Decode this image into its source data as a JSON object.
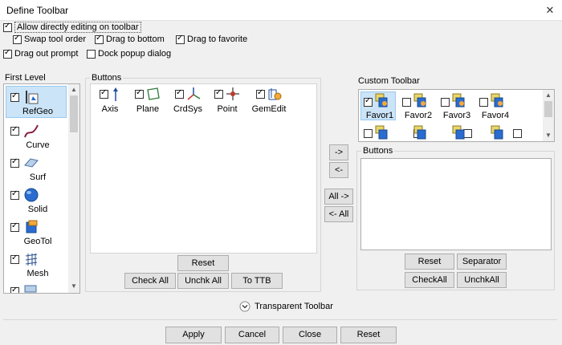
{
  "window": {
    "title": "Define Toolbar",
    "close_glyph": "✕"
  },
  "options": {
    "allow_direct_edit": "Allow directly editing on toolbar",
    "swap_tool_order": "Swap tool order",
    "drag_to_bottom": "Drag to bottom",
    "drag_to_favorite": "Drag to favorite",
    "drag_out_prompt": "Drag out prompt",
    "dock_popup_dialog": "Dock popup dialog"
  },
  "first_level": {
    "label": "First Level",
    "items": [
      {
        "label": "RefGeo",
        "icon": "refgeo-icon",
        "checked": true,
        "selected": true
      },
      {
        "label": "Curve",
        "icon": "curve-icon",
        "checked": true
      },
      {
        "label": "Surf",
        "icon": "surf-icon",
        "checked": true
      },
      {
        "label": "Solid",
        "icon": "solid-icon",
        "checked": true
      },
      {
        "label": "GeoTol",
        "icon": "geotol-icon",
        "checked": true
      },
      {
        "label": "Mesh",
        "icon": "mesh-icon",
        "checked": true
      }
    ]
  },
  "buttons_group": {
    "label": "Buttons",
    "tools": [
      {
        "label": "Axis",
        "icon": "axis-icon",
        "checked": true
      },
      {
        "label": "Plane",
        "icon": "plane-icon",
        "checked": true
      },
      {
        "label": "CrdSys",
        "icon": "crdsys-icon",
        "checked": true
      },
      {
        "label": "Point",
        "icon": "point-icon",
        "checked": true
      },
      {
        "label": "GemEdit",
        "icon": "gemedit-icon",
        "checked": true
      }
    ],
    "reset": "Reset",
    "check_all": "Check All",
    "uncheck_all": "Unchk All",
    "to_ttb": "To TTB"
  },
  "transfer": {
    "add": "->",
    "remove": "<-",
    "add_all": "All ->",
    "remove_all": "<- All"
  },
  "custom_toolbar": {
    "label": "Custom Toolbar",
    "favorites": [
      {
        "label": "Favor1",
        "checked": true,
        "selected": true
      },
      {
        "label": "Favor2",
        "checked": false
      },
      {
        "label": "Favor3",
        "checked": false
      },
      {
        "label": "Favor4",
        "checked": false
      }
    ],
    "buttons_label": "Buttons",
    "reset": "Reset",
    "separator": "Separator",
    "check_all": "CheckAll",
    "uncheck_all": "UnchkAll"
  },
  "transparent_toolbar": "Transparent Toolbar",
  "footer": {
    "apply": "Apply",
    "cancel": "Cancel",
    "close": "Close",
    "reset": "Reset"
  }
}
